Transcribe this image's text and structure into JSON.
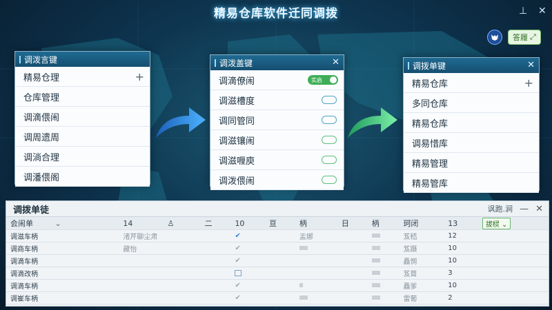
{
  "window": {
    "title": "精易仓库软件迁同调拨",
    "pin_icon": "⊥",
    "close_icon": "✕"
  },
  "user": {
    "avatar_label": "",
    "button_label": "答履"
  },
  "panels": [
    {
      "title": "调泼言键",
      "items": [
        "精易仓理",
        "仓库管理",
        "调滴偎闹",
        "调周遗周",
        "调淌合理",
        "调潘偎阁"
      ]
    },
    {
      "title": "调泼盖键",
      "toggle_label": "实启",
      "items": [
        "调滴僚闹",
        "调滋槽度",
        "调同管同",
        "调滋镶闹",
        "调滋喱庾",
        "调泼偎闹"
      ]
    },
    {
      "title": "调拨单键",
      "items": [
        "精易仓库",
        "多同仓库",
        "精易仓库",
        "调易惜库",
        "精易管理",
        "精易管库"
      ]
    }
  ],
  "bottom": {
    "title": "调拨单徒",
    "right_label": "讽跑.涧",
    "columns": [
      "会闹单",
      "14",
      "",
      "二",
      "10",
      "亘",
      "柄",
      "日",
      "柄",
      "珂闭",
      "13",
      "拔棂"
    ],
    "rows": [
      {
        "name": "调滋车柄",
        "c2": "渚芹聊尘肃",
        "mark": "check",
        "c8": "盂娜",
        "c10": "芨嵇",
        "c11": "12"
      },
      {
        "name": "调商车柄",
        "c2": "藏怡",
        "mark": "check",
        "c8": "",
        "c10": "芨蹑",
        "c11": "10"
      },
      {
        "name": "调滴车柄",
        "c2": "",
        "mark": "check",
        "c8": "",
        "c10": "矗惆",
        "c11": "10"
      },
      {
        "name": "调滴改柄",
        "c2": "",
        "mark": "box",
        "c8": "",
        "c10": "芨葺",
        "c11": "3"
      },
      {
        "name": "调滴车柄",
        "c2": "",
        "mark": "check",
        "c8": "",
        "c10": "矗爹",
        "c11": "10"
      },
      {
        "name": "调崔车柄",
        "c2": "",
        "mark": "check",
        "c8": "",
        "c10": "雷葡",
        "c11": "2"
      }
    ]
  },
  "colors": {
    "accent": "#1f6a92",
    "green": "#3fae57",
    "bg": "#0a2236"
  }
}
